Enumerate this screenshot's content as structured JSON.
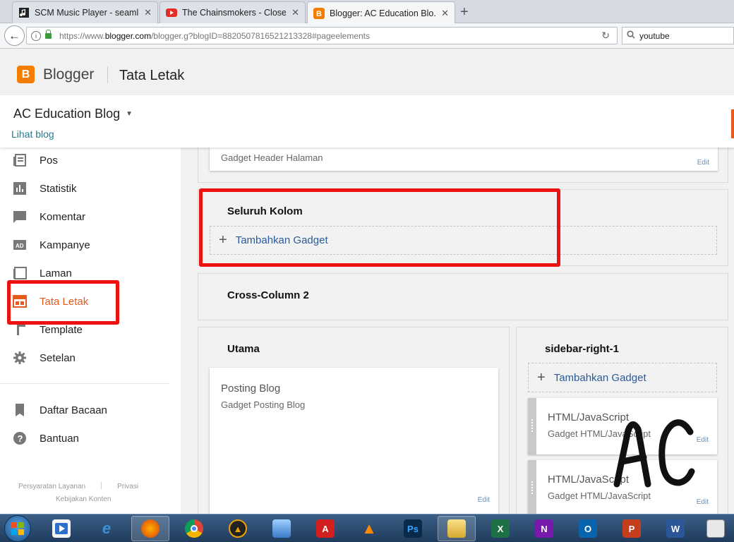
{
  "browser": {
    "tabs": [
      {
        "title": "SCM Music Player - seamle...",
        "active": false
      },
      {
        "title": "The Chainsmokers - Closer...",
        "active": false
      },
      {
        "title": "Blogger: AC Education Blo...",
        "active": true
      }
    ],
    "url_prefix": "https://www.",
    "url_host": "blogger.com",
    "url_path": "/blogger.g?blogID=8820507816521213328#pageelements",
    "search_value": "youtube"
  },
  "header": {
    "brand": "Blogger",
    "logo_letter": "B",
    "page_title": "Tata Letak"
  },
  "blog": {
    "name": "AC Education Blog",
    "view_link": "Lihat blog"
  },
  "sidebar": {
    "items": [
      {
        "label": "Pos",
        "icon": "posts-icon"
      },
      {
        "label": "Statistik",
        "icon": "stats-icon"
      },
      {
        "label": "Komentar",
        "icon": "comment-icon"
      },
      {
        "label": "Kampanye",
        "icon": "ad-icon"
      },
      {
        "label": "Laman",
        "icon": "page-icon"
      },
      {
        "label": "Tata Letak",
        "icon": "layout-icon",
        "active": true
      },
      {
        "label": "Template",
        "icon": "template-icon"
      },
      {
        "label": "Setelan",
        "icon": "gear-icon"
      }
    ],
    "secondary": [
      {
        "label": "Daftar Bacaan",
        "icon": "bookmark-icon"
      },
      {
        "label": "Bantuan",
        "icon": "help-icon"
      }
    ],
    "footer": {
      "terms": "Persyaratan Layanan",
      "privacy": "Privasi",
      "content_policy": "Kebijakan Konten"
    }
  },
  "layout": {
    "page_header_gadget": "Gadget Header Halaman",
    "edit_label": "Edit",
    "add_gadget_label": "Tambahkan Gadget",
    "sections": {
      "all_columns": "Seluruh Kolom",
      "cross_column_2": "Cross-Column 2",
      "main": "Utama",
      "sidebar_right": "sidebar-right-1"
    },
    "blog_posts_gadget": {
      "title": "Posting Blog",
      "subtitle": "Gadget Posting Blog"
    },
    "html_gadgets": [
      {
        "title": "HTML/JavaScript",
        "subtitle": "Gadget HTML/JavaScript"
      },
      {
        "title": "HTML/JavaScript",
        "subtitle": "Gadget HTML/JavaScript"
      }
    ]
  },
  "overlay_text": "AC",
  "colors": {
    "accent": "#e8591c",
    "highlight_box": "#ee1111",
    "link": "#2a5b9a"
  }
}
